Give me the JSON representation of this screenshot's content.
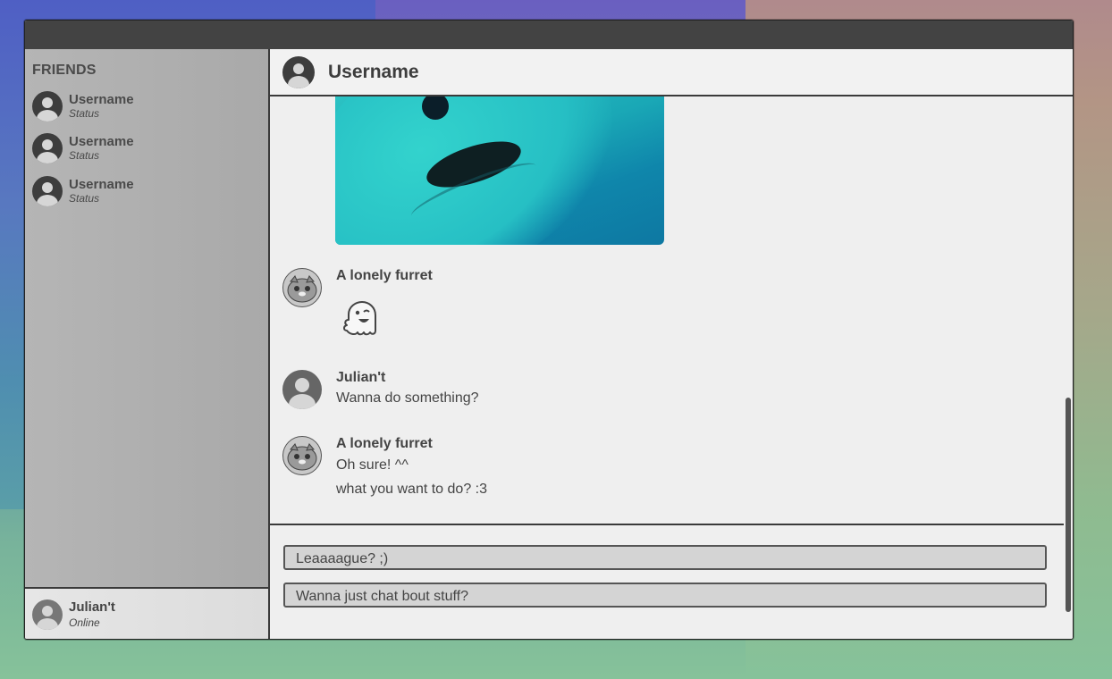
{
  "sidebar": {
    "heading": "FRIENDS",
    "friends": [
      {
        "name": "Username",
        "status": "Status"
      },
      {
        "name": "Username",
        "status": "Status"
      },
      {
        "name": "Username",
        "status": "Status"
      }
    ],
    "self": {
      "name": "Julian't",
      "status": "Online"
    }
  },
  "chat": {
    "title": "Username",
    "messages": [
      {
        "author": "A lonely furret",
        "sticker": "ghost-wink-icon"
      },
      {
        "author": "Julian't",
        "lines": [
          "Wanna do something?"
        ]
      },
      {
        "author": "A lonely furret",
        "lines": [
          "Oh sure! ^^",
          "what you want to do? :3"
        ]
      }
    ],
    "choices": [
      "Leaaaague? ;)",
      "Wanna just chat bout stuff?"
    ]
  },
  "colors": {
    "titlebar": "#434343",
    "sidebar": "#b0b0b0",
    "chat_bg": "#efefef"
  }
}
